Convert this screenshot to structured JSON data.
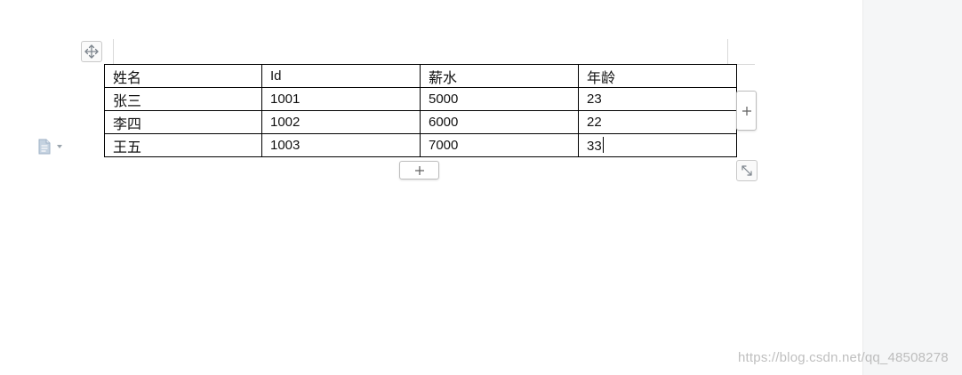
{
  "table": {
    "rows": [
      [
        "姓名",
        "Id",
        "薪水",
        "年龄"
      ],
      [
        "张三",
        "1001",
        "5000",
        "23"
      ],
      [
        "李四",
        "1002",
        "6000",
        "22"
      ],
      [
        "王五",
        "1003",
        "7000",
        "33"
      ]
    ]
  },
  "controls": {
    "move_handle_icon": "move-arrows-icon",
    "add_column_icon": "plus-icon",
    "add_row_icon": "plus-icon",
    "resize_icon": "diagonal-resize-icon",
    "doc_menu_icon": "document-icon",
    "add_symbol": "+"
  },
  "watermark": "https://blog.csdn.net/qq_48508278",
  "colors": {
    "table_border": "#000000",
    "gutter": "#f5f6f7",
    "icon": "#8a9199",
    "doc_icon": "#a9b8c8"
  }
}
